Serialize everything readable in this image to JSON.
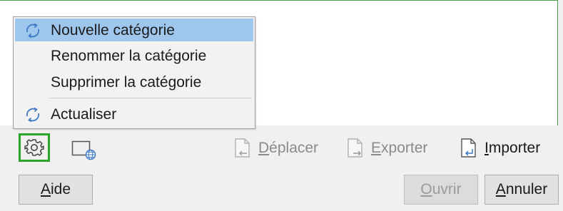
{
  "context_menu": {
    "items": [
      {
        "label": "Nouvelle catégorie",
        "icon": "refresh-icon",
        "highlighted": true
      },
      {
        "label": "Renommer la catégorie",
        "icon": null,
        "highlighted": false
      },
      {
        "label": "Supprimer la catégorie",
        "icon": null,
        "highlighted": false
      },
      {
        "label": "Actualiser",
        "icon": "refresh-icon",
        "highlighted": false
      }
    ]
  },
  "toolbar": {
    "settings_icon": "gear-icon",
    "online_icon": "globe-window-icon",
    "move": {
      "label_u": "D",
      "label_rest": "éplacer",
      "icon": "move-document-icon",
      "enabled": false
    },
    "export": {
      "label_u": "E",
      "label_rest": "xporter",
      "icon": "export-document-icon",
      "enabled": false
    },
    "import": {
      "label_u": "I",
      "label_rest": "mporter",
      "icon": "import-document-icon",
      "enabled": true
    }
  },
  "buttons": {
    "help": {
      "label_u": "A",
      "label_rest": "ide"
    },
    "open": {
      "label_u": "O",
      "label_rest": "uvrir",
      "enabled": false
    },
    "cancel": {
      "label_u": "A",
      "label_rest": "nnuler"
    }
  },
  "colors": {
    "highlight": "#9fc7ee",
    "focus_border": "#2aa52a",
    "icon_blue": "#3a78c4"
  }
}
